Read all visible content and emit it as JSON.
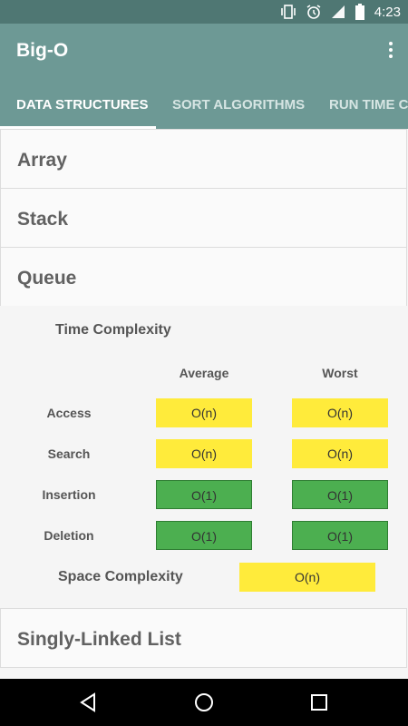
{
  "status_bar": {
    "time": "4:23",
    "icons": [
      "vibrate-icon",
      "alarm-icon",
      "signal-icon",
      "battery-icon"
    ]
  },
  "app_bar": {
    "title": "Big-O",
    "overflow_icon": "more-vert-icon"
  },
  "tabs": [
    {
      "label": "DATA STRUCTURES",
      "active": true
    },
    {
      "label": "SORT ALGORITHMS",
      "active": false
    },
    {
      "label": "RUN TIME CO",
      "active": false
    }
  ],
  "items": [
    {
      "label": "Array"
    },
    {
      "label": "Stack"
    },
    {
      "label": "Queue",
      "expanded": true
    },
    {
      "label": "Singly-Linked List"
    }
  ],
  "queue_details": {
    "time_title": "Time Complexity",
    "columns": [
      "Average",
      "Worst"
    ],
    "rows": [
      {
        "label": "Access",
        "average": "O(n)",
        "worst": "O(n)",
        "color": "yellow"
      },
      {
        "label": "Search",
        "average": "O(n)",
        "worst": "O(n)",
        "color": "yellow"
      },
      {
        "label": "Insertion",
        "average": "O(1)",
        "worst": "O(1)",
        "color": "green"
      },
      {
        "label": "Deletion",
        "average": "O(1)",
        "worst": "O(1)",
        "color": "green"
      }
    ],
    "space_title": "Space Complexity",
    "space_value": "O(n)"
  },
  "colors": {
    "primary": "#6d9995",
    "primary_dark": "#4f7773",
    "yellow": "#ffeb3b",
    "green": "#4caf50"
  },
  "nav": [
    "back-icon",
    "home-icon",
    "recents-icon"
  ]
}
